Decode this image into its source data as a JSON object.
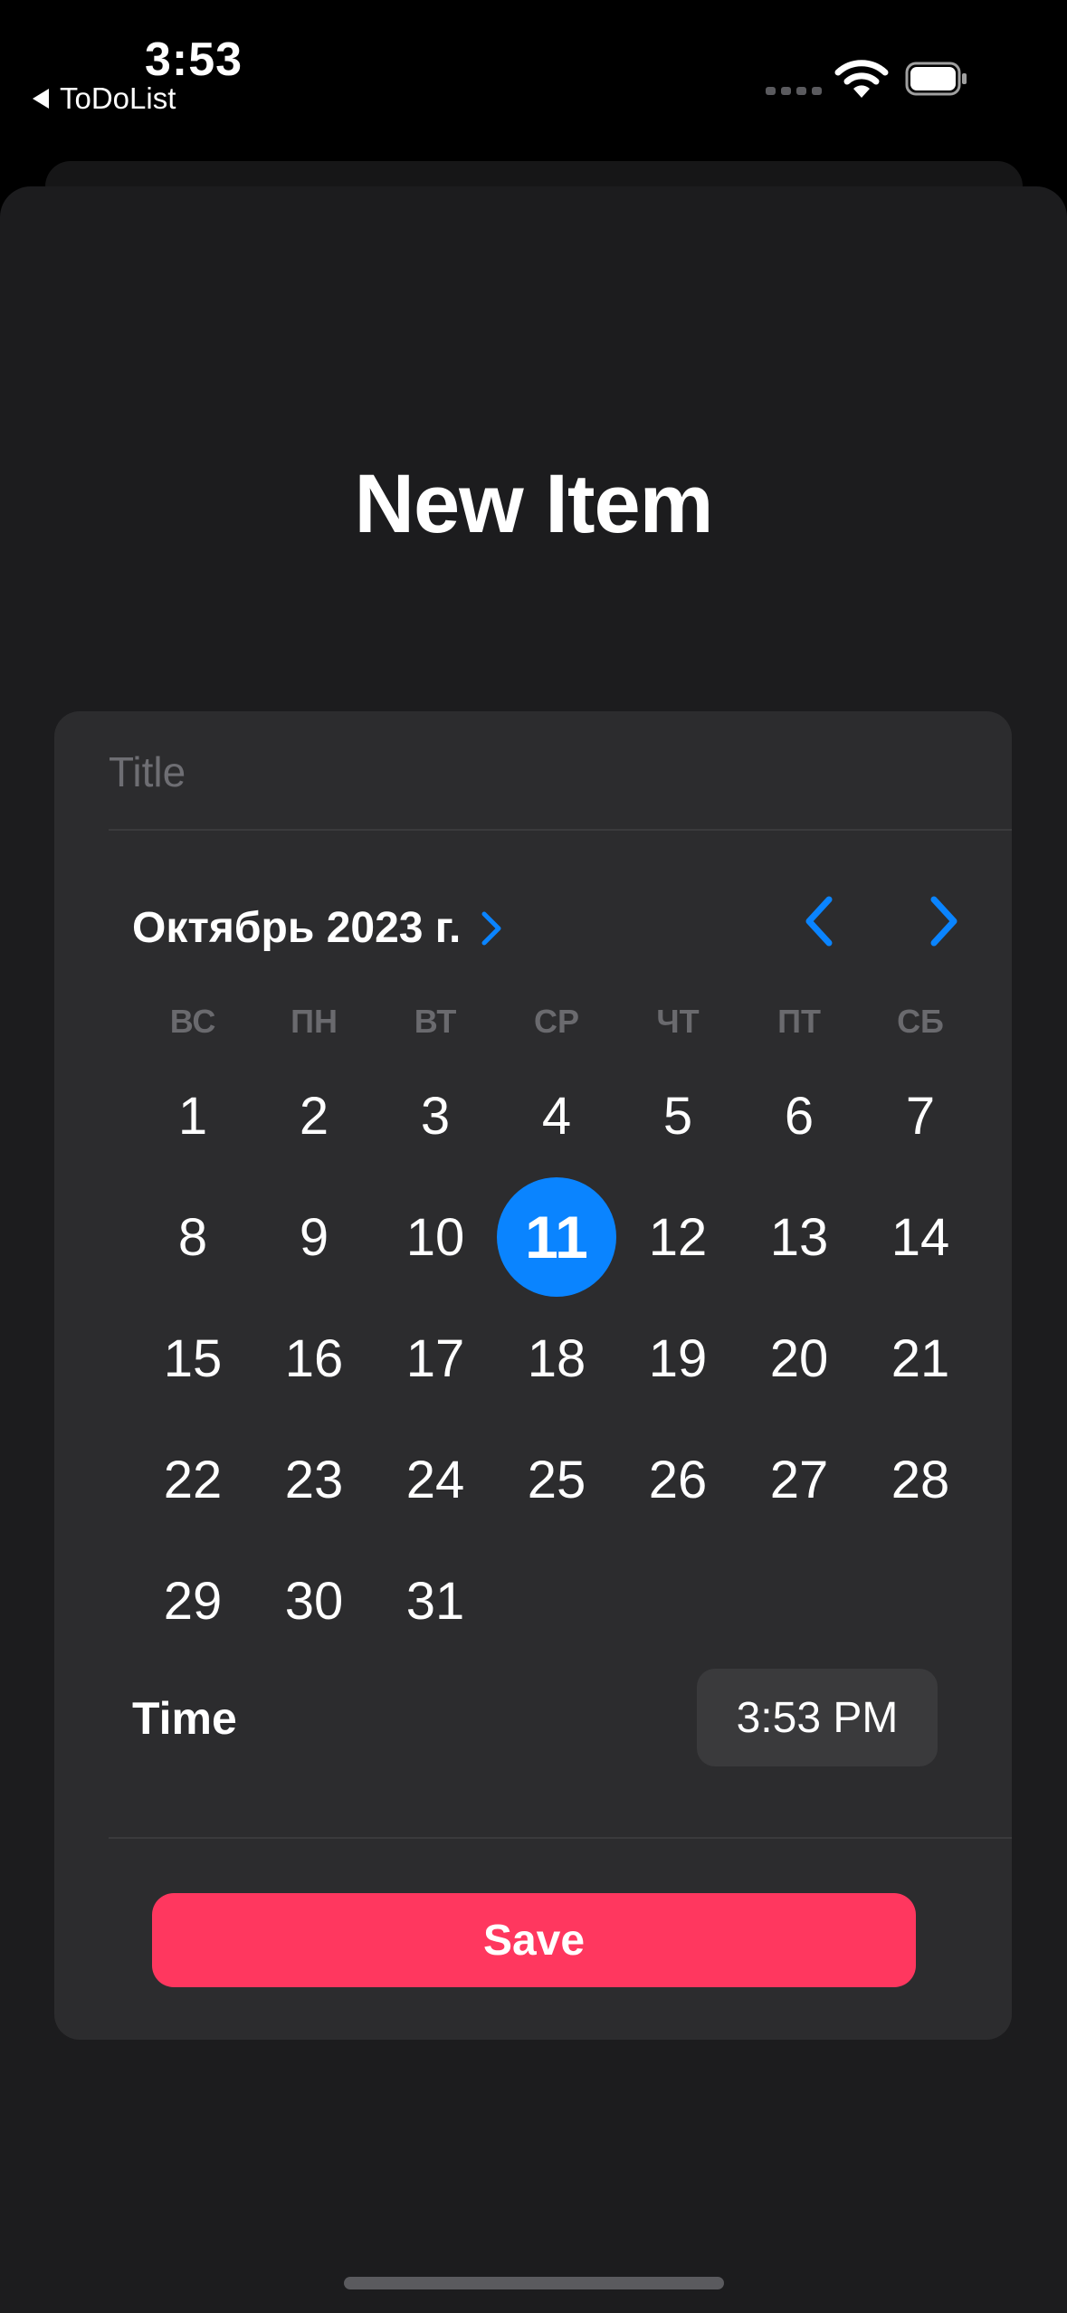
{
  "status_bar": {
    "time": "3:53",
    "back_app": "ToDoList"
  },
  "page": {
    "title": "New Item"
  },
  "form": {
    "title_placeholder": "Title",
    "calendar": {
      "month_label": "Октябрь 2023 г.",
      "weekdays": [
        "ВС",
        "ПН",
        "ВТ",
        "СР",
        "ЧТ",
        "ПТ",
        "СБ"
      ],
      "days": [
        "1",
        "2",
        "3",
        "4",
        "5",
        "6",
        "7",
        "8",
        "9",
        "10",
        "11",
        "12",
        "13",
        "14",
        "15",
        "16",
        "17",
        "18",
        "19",
        "20",
        "21",
        "22",
        "23",
        "24",
        "25",
        "26",
        "27",
        "28",
        "29",
        "30",
        "31"
      ],
      "selected_day": "11"
    },
    "time_label": "Time",
    "time_value": "3:53 PM",
    "save_label": "Save"
  },
  "colors": {
    "accent": "#0a84ff",
    "save": "#ff375f",
    "background": "#1c1c1e",
    "card": "#2c2c2e"
  },
  "icons": {
    "back": "back-triangle-icon",
    "month_expand": "chevron-right-icon",
    "prev_month": "chevron-left-icon",
    "next_month": "chevron-right-icon"
  }
}
